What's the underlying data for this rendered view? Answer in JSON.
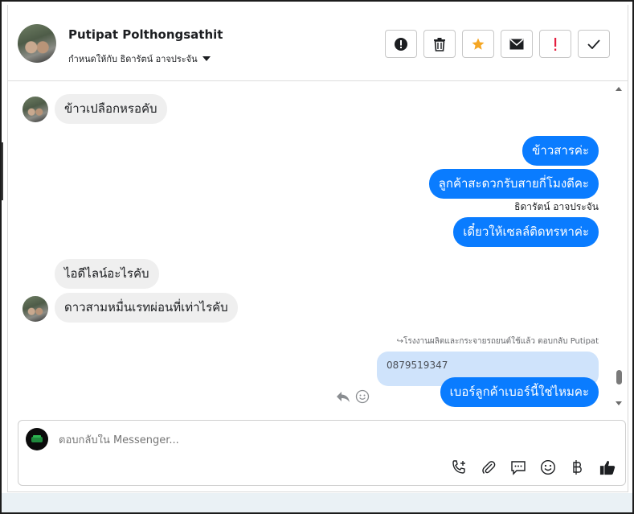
{
  "header": {
    "name": "Putipat Polthongsathit",
    "assign_label": "กำหนดให้กับ ธิดารัตน์ อาจประจัน",
    "toolbar": [
      "spam-icon",
      "trash-icon",
      "star-icon",
      "mail-icon",
      "alert-icon",
      "check-icon"
    ]
  },
  "messages": {
    "m1": "ข้าวเปลือกหรอคับ",
    "m2": "ข้าวสารค่ะ",
    "m3": "ลูกค้าสะดวกรับสายกี่โมงดีคะ",
    "sender": "ธิดารัตน์ อาจประจัน",
    "m4": "เดี๋ยวให้เซลล์ติดทรหาค่ะ",
    "m5": "ไอดีไลน์อะไรคับ",
    "m6": "ดาวสามหมื่นเรทผ่อนที่เท่าไรคับ",
    "reply_note": "↪โรงงานผลิตและกระจายรถยนต์ใช้แล้ว ตอบกลับ Putipat",
    "quoted": "0879519347",
    "m7": "เบอร์ลูกค้าเบอร์นี้ใช่ไหมคะ"
  },
  "composer": {
    "placeholder": "ตอบกลับใน Messenger...",
    "tools": [
      "phone-add-icon",
      "attach-icon",
      "comment-icon",
      "emoji-icon",
      "baht-icon",
      "thumbs-up-icon"
    ]
  },
  "colors": {
    "outgoing": "#0a7cff",
    "incoming": "#efefef",
    "quoted": "#cfe3fb",
    "star": "#f5a623",
    "alert": "#e41e3f"
  }
}
